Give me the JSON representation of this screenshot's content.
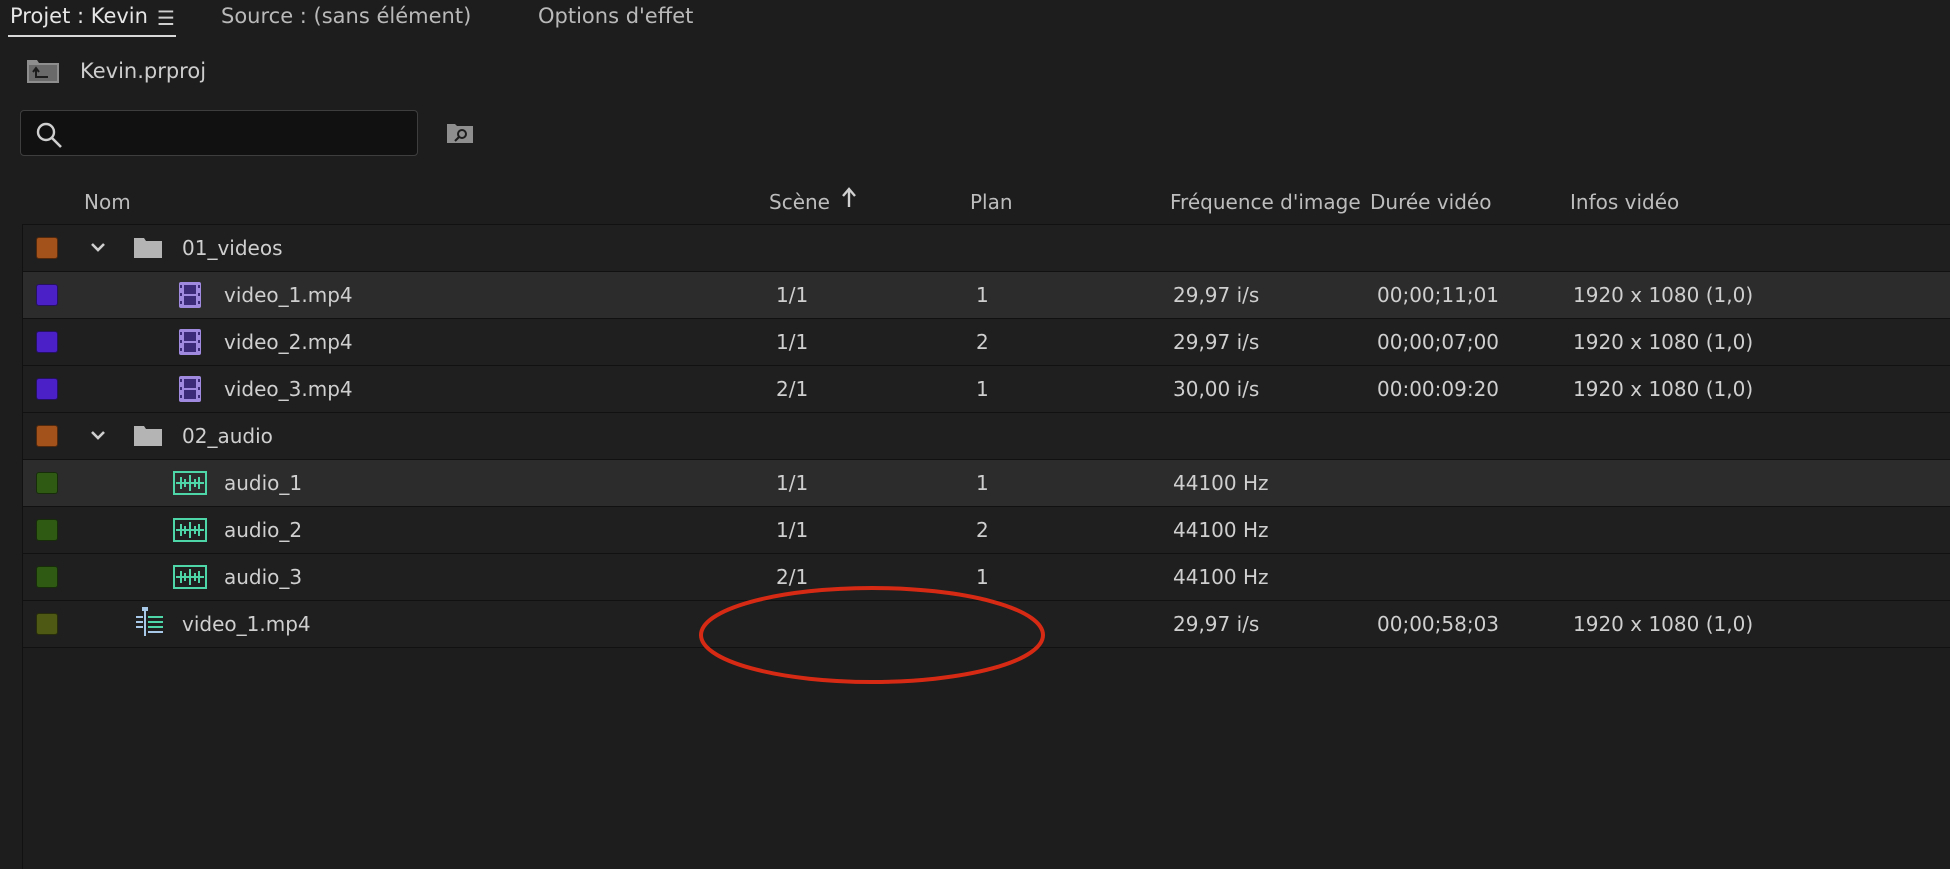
{
  "tabs": {
    "project": "Projet : Kevin",
    "source": "Source : (sans élément)",
    "effects": "Options d'effet"
  },
  "project": {
    "name": "Kevin.prproj"
  },
  "search": {
    "value": "",
    "placeholder": ""
  },
  "columns": {
    "name": "Nom",
    "scene": "Scène",
    "plan": "Plan",
    "frame_rate": "Fréquence d'image",
    "video_duration": "Durée vidéo",
    "video_info": "Infos vidéo"
  },
  "colors": {
    "folder_label": "#a4521b",
    "video_label": "#4b20c7",
    "audio_label": "#2e5a14",
    "sequence_label": "#4e5a14",
    "annotation": "#d62a14"
  },
  "rows": [
    {
      "type": "folder",
      "icon": "folder-icon",
      "name": "01_videos",
      "scene": "",
      "plan": "",
      "frame_rate": "",
      "duration": "",
      "info": ""
    },
    {
      "type": "video",
      "icon": "film-strip-icon",
      "name": "video_1.mp4",
      "scene": "1/1",
      "plan": "1",
      "frame_rate": "29,97 i/s",
      "duration": "00;00;11;01",
      "info": "1920 x 1080 (1,0)"
    },
    {
      "type": "video",
      "icon": "film-strip-icon",
      "name": "video_2.mp4",
      "scene": "1/1",
      "plan": "2",
      "frame_rate": "29,97 i/s",
      "duration": "00;00;07;00",
      "info": "1920 x 1080 (1,0)"
    },
    {
      "type": "video",
      "icon": "film-strip-icon",
      "name": "video_3.mp4",
      "scene": "2/1",
      "plan": "1",
      "frame_rate": "30,00 i/s",
      "duration": "00:00:09:20",
      "info": "1920 x 1080 (1,0)"
    },
    {
      "type": "folder",
      "icon": "folder-icon",
      "name": "02_audio",
      "scene": "",
      "plan": "",
      "frame_rate": "",
      "duration": "",
      "info": ""
    },
    {
      "type": "audio",
      "icon": "waveform-icon",
      "name": "audio_1",
      "scene": "1/1",
      "plan": "1",
      "frame_rate": "44100  Hz",
      "duration": "",
      "info": ""
    },
    {
      "type": "audio",
      "icon": "waveform-icon",
      "name": "audio_2",
      "scene": "1/1",
      "plan": "2",
      "frame_rate": "44100  Hz",
      "duration": "",
      "info": ""
    },
    {
      "type": "audio",
      "icon": "waveform-icon",
      "name": "audio_3",
      "scene": "2/1",
      "plan": "1",
      "frame_rate": "44100  Hz",
      "duration": "",
      "info": ""
    },
    {
      "type": "sequence",
      "icon": "sequence-icon",
      "name": "video_1.mp4",
      "scene": "",
      "plan": "",
      "frame_rate": "29,97 i/s",
      "duration": "00;00;58;03",
      "info": "1920 x 1080 (1,0)"
    }
  ]
}
